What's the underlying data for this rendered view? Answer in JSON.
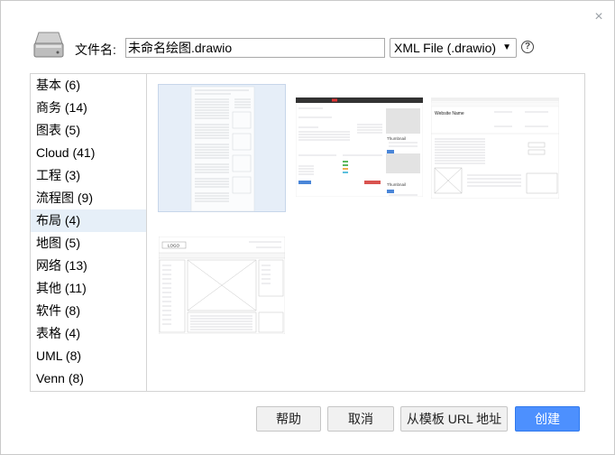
{
  "filename": {
    "label": "文件名:",
    "value": "未命名绘图.drawio"
  },
  "format": {
    "selected": "XML File (.drawio)",
    "arrow": "▼"
  },
  "help_icon": "?",
  "close_icon": "×",
  "categories": [
    {
      "label": "基本 (6)"
    },
    {
      "label": "商务 (14)"
    },
    {
      "label": "图表 (5)"
    },
    {
      "label": "Cloud (41)"
    },
    {
      "label": "工程 (3)"
    },
    {
      "label": "流程图 (9)"
    },
    {
      "label": "布局 (4)",
      "active": true
    },
    {
      "label": "地图 (5)"
    },
    {
      "label": "网络 (13)"
    },
    {
      "label": "其他 (11)"
    },
    {
      "label": "软件 (8)"
    },
    {
      "label": "表格 (4)"
    },
    {
      "label": "UML (8)"
    },
    {
      "label": "Venn (8)"
    }
  ],
  "templates": {
    "t2": {
      "thumb_label_1": "Thumbnail",
      "thumb_label_2": "Thumbnail"
    },
    "t3": {
      "site_name": "Website Name"
    },
    "t4": {
      "logo": "LOGO"
    }
  },
  "buttons": {
    "help": "帮助",
    "cancel": "取消",
    "from_url": "从模板 URL 地址",
    "create": "创建"
  },
  "colors": {
    "accent": "#4d90fe",
    "selected_bg": "#e6eff8"
  }
}
